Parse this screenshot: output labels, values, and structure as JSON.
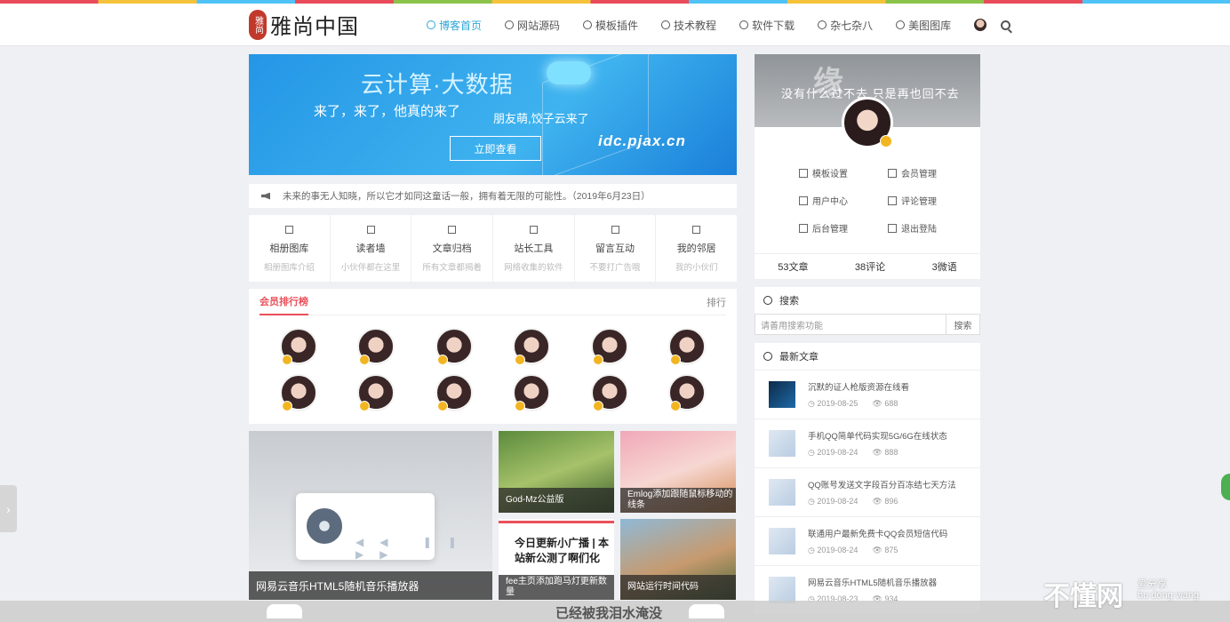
{
  "brand": {
    "seal": "雅尚",
    "name": "雅尚中国"
  },
  "nav": {
    "items": [
      {
        "label": "博客首页",
        "active": true
      },
      {
        "label": "网站源码"
      },
      {
        "label": "模板插件"
      },
      {
        "label": "技术教程"
      },
      {
        "label": "软件下载"
      },
      {
        "label": "杂七杂八"
      },
      {
        "label": "美图图库"
      }
    ]
  },
  "banner": {
    "title": "云计算·大数据",
    "slogan": "来了，来了，他真的来了",
    "sub": "朋友萌,饺子云来了",
    "button": "立即查看",
    "url": "idc.pjax.cn"
  },
  "notice": "未来的事无人知晓，所以它才如同这童话一般，拥有着无限的可能性。（2019年6月23日）",
  "shortcuts": [
    {
      "title": "相册图库",
      "sub": "相册图库介绍"
    },
    {
      "title": "读者墙",
      "sub": "小伙伴都在这里"
    },
    {
      "title": "文章归档",
      "sub": "所有文章都揭着"
    },
    {
      "title": "站长工具",
      "sub": "网络收集的软件"
    },
    {
      "title": "留言互动",
      "sub": "不要打广告哦"
    },
    {
      "title": "我的邻居",
      "sub": "我的小伙们"
    }
  ],
  "rank": {
    "title": "会员排行榜",
    "more": "排行",
    "count": 12
  },
  "gallery": {
    "big": "网易云音乐HTML5随机音乐播放器",
    "tiles": [
      "God-Mz公益版",
      "Emlog添加跟随鼠标移动的线条",
      "fee主页添加跑马灯更新数量",
      "网站运行时间代码"
    ],
    "poster": "今日更新小广播 | 本站新公测了啊们化"
  },
  "profile": {
    "cover_text": "没有什么过不去 只是再也回不去",
    "menu": [
      "模板设置",
      "会员管理",
      "用户中心",
      "评论管理",
      "后台管理",
      "退出登陆"
    ],
    "stats": [
      "53文章",
      "38评论",
      "3微语"
    ]
  },
  "search": {
    "title": "搜索",
    "placeholder": "请善用搜索功能",
    "button": "搜索"
  },
  "recent": {
    "title": "最新文章",
    "items": [
      {
        "title": "沉默的证人枪版资源在线看",
        "date": "2019-08-25",
        "views": "688"
      },
      {
        "title": "手机QQ简单代码实现5G/6G在线状态",
        "date": "2019-08-24",
        "views": "888"
      },
      {
        "title": "QQ账号发送文字段百分百冻结七天方法",
        "date": "2019-08-24",
        "views": "896"
      },
      {
        "title": "联通用户最新免费卡QQ会员短信代码",
        "date": "2019-08-24",
        "views": "875"
      },
      {
        "title": "网易云音乐HTML5随机音乐播放器",
        "date": "2019-08-23",
        "views": "934"
      }
    ]
  },
  "bottom": {
    "text": "已经被我泪水淹没"
  },
  "watermark": {
    "big": "不懂网",
    "small1": "爱分享",
    "small2": "bu dong wang"
  },
  "colors": {
    "accent": "#2fa7d8",
    "rank": "#e9505a"
  }
}
